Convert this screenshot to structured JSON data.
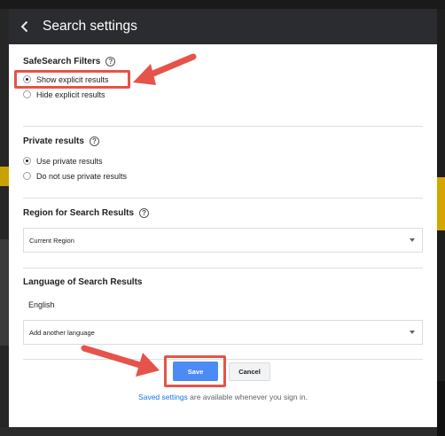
{
  "header": {
    "title": "Search settings"
  },
  "safesearch": {
    "heading": "SafeSearch Filters",
    "options": [
      {
        "label": "Show explicit results",
        "checked": true
      },
      {
        "label": "Hide explicit results",
        "checked": false
      }
    ]
  },
  "private": {
    "heading": "Private results",
    "options": [
      {
        "label": "Use private results",
        "checked": true
      },
      {
        "label": "Do not use private results",
        "checked": false
      }
    ]
  },
  "region": {
    "heading": "Region for Search Results",
    "selected": "Current Region"
  },
  "language": {
    "heading": "Language of Search Results",
    "current": "English",
    "add_placeholder": "Add another language"
  },
  "actions": {
    "save_label": "Save",
    "cancel_label": "Cancel"
  },
  "footer": {
    "link_text": "Saved settings",
    "rest_text": " are available whenever you sign in."
  },
  "colors": {
    "annotation": "#e5534b",
    "primary": "#4c8bf5",
    "titlebar": "#2b2c2f"
  },
  "icons": {
    "back": "chevron-left-icon",
    "help": "help-circle-icon",
    "dropdown": "caret-down-icon",
    "arrow": "annotation-arrow"
  }
}
